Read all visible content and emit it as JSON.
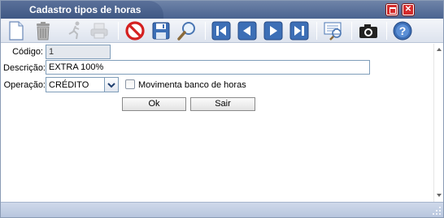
{
  "window": {
    "title": "Cadastro tipos de horas"
  },
  "toolbar": {
    "buttons": [
      {
        "icon": "new-document-icon",
        "enabled": true
      },
      {
        "icon": "trash-icon",
        "enabled": true
      },
      {
        "icon": "run-icon",
        "enabled": false
      },
      {
        "icon": "print-icon",
        "enabled": false
      },
      {
        "icon": "cancel-icon",
        "enabled": true
      },
      {
        "icon": "save-icon",
        "enabled": true
      },
      {
        "icon": "search-icon",
        "enabled": true
      },
      {
        "icon": "first-record-icon",
        "enabled": true
      },
      {
        "icon": "previous-record-icon",
        "enabled": true
      },
      {
        "icon": "next-record-icon",
        "enabled": true
      },
      {
        "icon": "last-record-icon",
        "enabled": true
      },
      {
        "icon": "report-icon",
        "enabled": true
      },
      {
        "icon": "camera-icon",
        "enabled": true
      },
      {
        "icon": "help-icon",
        "enabled": true
      }
    ]
  },
  "form": {
    "codigo_label": "Código:",
    "codigo_value": "1",
    "descricao_label": "Descrição:",
    "descricao_value": "EXTRA 100%",
    "operacao_label": "Operação:",
    "operacao_value": "CRÉDITO",
    "movimenta_label": "Movimenta banco de horas",
    "movimenta_checked": false,
    "ok_label": "Ok",
    "sair_label": "Sair"
  },
  "colors": {
    "titlebar": "#4a6390",
    "statusbar": "#b8c6de",
    "accent_blue": "#3d6fb6",
    "cancel_red": "#d42020"
  }
}
